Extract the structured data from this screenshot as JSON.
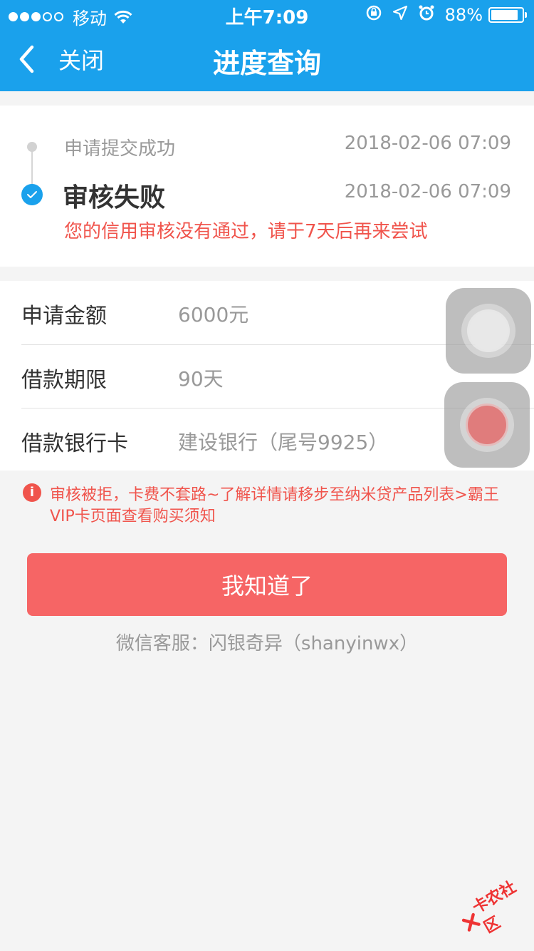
{
  "status_bar": {
    "carrier": "移动",
    "time": "上午7:09",
    "battery": "88%",
    "battery_level": 0.88,
    "signal_full": 3,
    "signal_empty": 2
  },
  "nav": {
    "back_label": "关闭",
    "title": "进度查询"
  },
  "timeline": {
    "steps": [
      {
        "label": "申请提交成功",
        "time": "2018-02-06 07:09"
      },
      {
        "label": "审核失败",
        "time": "2018-02-06 07:09",
        "message": "您的信用审核没有通过，请于7天后再来尝试"
      }
    ]
  },
  "info": {
    "rows": [
      {
        "label": "申请金额",
        "value": "6000元"
      },
      {
        "label": "借款期限",
        "value": "90天"
      },
      {
        "label": "借款银行卡",
        "value": "建设银行（尾号9925）"
      }
    ]
  },
  "notice": {
    "icon_text": "i",
    "text": "审核被拒，卡费不套路~了解详情请移步至纳米贷产品列表>霸王VIP卡页面查看购买须知"
  },
  "confirm_button": "我知道了",
  "wechat": "微信客服：闪银奇异（shanyinwx）",
  "watermark": "卡农社区",
  "colors": {
    "brand_blue": "#1aa1ec",
    "error_red": "#f0544c",
    "button_red": "#f66565"
  }
}
